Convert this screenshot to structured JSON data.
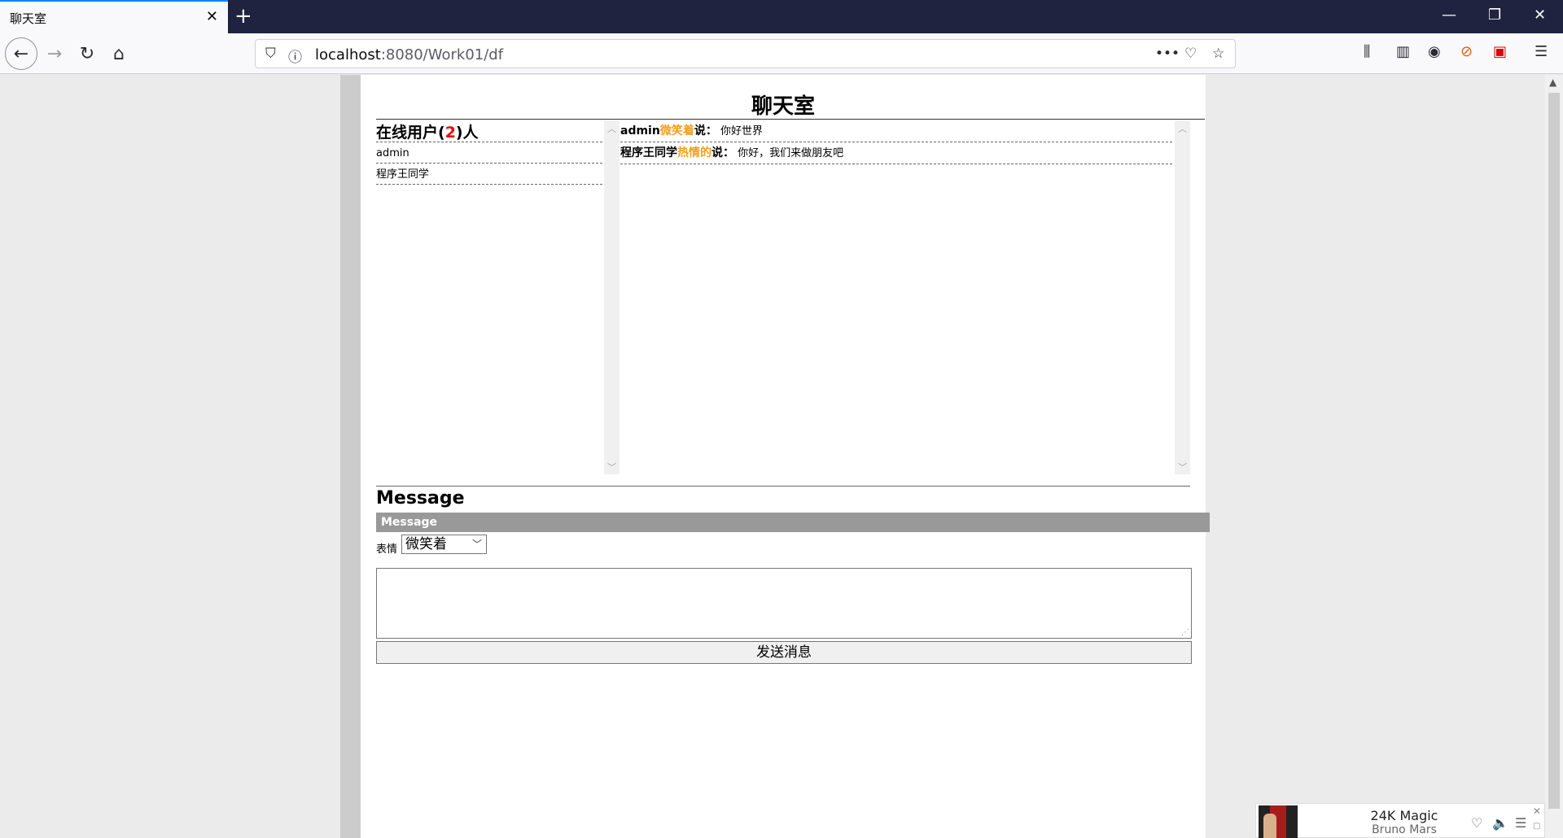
{
  "browser": {
    "tab_title": "聊天室",
    "tab_close": "✕",
    "new_tab": "+",
    "url_host": "localhost",
    "url_rest": ":8080/Work01/df"
  },
  "chat": {
    "title": "聊天室",
    "users_label_prefix": "在线用户(",
    "online_count": "2",
    "users_label_suffix": ")人",
    "users": [
      "admin",
      "程序王同学"
    ],
    "messages": [
      {
        "user": "admin",
        "emotion": "微笑着",
        "say": "说：",
        "text": "你好世界"
      },
      {
        "user": "程序王同学",
        "emotion": "热情的",
        "say": "说：",
        "text": "你好，我们来做朋友吧"
      }
    ]
  },
  "composer": {
    "heading": "Message",
    "bar_label": "Message",
    "emotion_label": "表情",
    "emotion_selected": "微笑着",
    "send_label": "发送消息"
  },
  "music": {
    "song": "24K Magic",
    "artist": "Bruno Mars"
  }
}
